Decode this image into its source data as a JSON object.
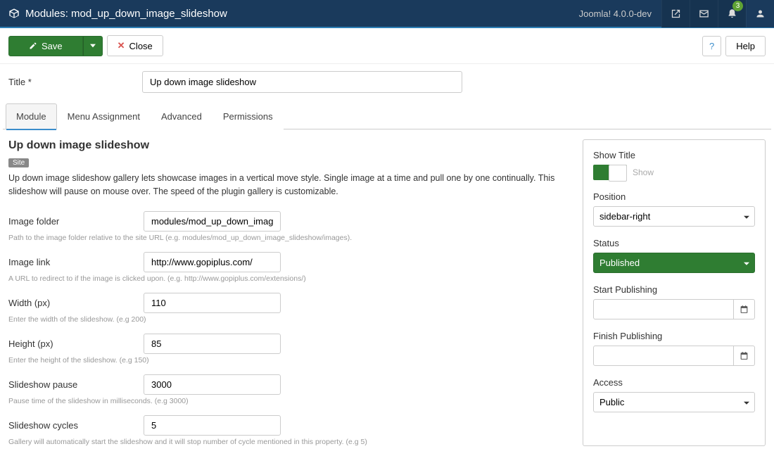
{
  "topnav": {
    "page_title": "Modules: mod_up_down_image_slideshow",
    "brand": "Joomla! 4.0.0-dev",
    "notifications_count": "3"
  },
  "toolbar": {
    "save_label": "Save",
    "close_label": "Close",
    "help_label": "Help",
    "help_q": "?"
  },
  "title_field": {
    "label": "Title *",
    "value": "Up down image slideshow"
  },
  "tabs": {
    "module": "Module",
    "menu_assignment": "Menu Assignment",
    "advanced": "Advanced",
    "permissions": "Permissions"
  },
  "module": {
    "heading": "Up down image slideshow",
    "badge": "Site",
    "description": "Up down image slideshow gallery lets showcase images in a vertical move style. Single image at a time and pull one by one continually. This slideshow will pause on mouse over. The speed of the plugin gallery is customizable.",
    "fields": {
      "image_folder": {
        "label": "Image folder",
        "value": "modules/mod_up_down_image_sli",
        "help": "Path to the image folder relative to the site URL (e.g. modules/mod_up_down_image_slideshow/images)."
      },
      "image_link": {
        "label": "Image link",
        "value": "http://www.gopiplus.com/",
        "help": "A URL to redirect to if the image is clicked upon. (e.g. http://www.gopiplus.com/extensions/)"
      },
      "width": {
        "label": "Width (px)",
        "value": "110",
        "help": "Enter the width of the slideshow. (e.g 200)"
      },
      "height": {
        "label": "Height (px)",
        "value": "85",
        "help": "Enter the height of the slideshow. (e.g 150)"
      },
      "pause": {
        "label": "Slideshow pause",
        "value": "3000",
        "help": "Pause time of the slideshow in milliseconds. (e.g 3000)"
      },
      "cycles": {
        "label": "Slideshow cycles",
        "value": "5",
        "help": "Gallery will automatically start the slideshow and it will stop number of cycle mentioned in this property. (e.g 5)"
      }
    }
  },
  "sidebar": {
    "show_title": {
      "label": "Show Title",
      "state_text": "Show"
    },
    "position": {
      "label": "Position",
      "value": "sidebar-right"
    },
    "status": {
      "label": "Status",
      "value": "Published"
    },
    "start": {
      "label": "Start Publishing",
      "value": ""
    },
    "finish": {
      "label": "Finish Publishing",
      "value": ""
    },
    "access": {
      "label": "Access",
      "value": "Public"
    }
  }
}
